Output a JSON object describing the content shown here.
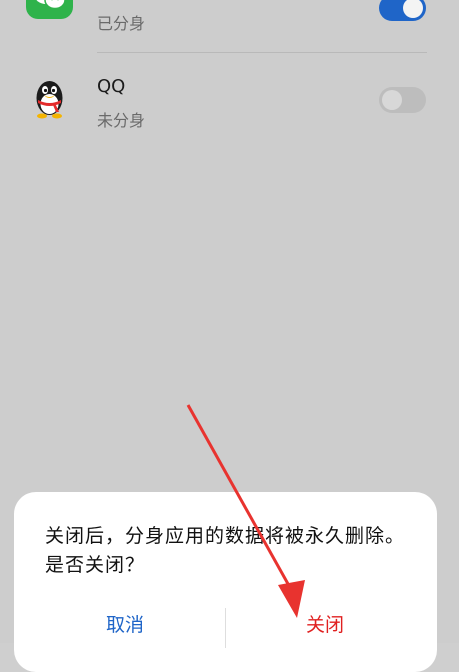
{
  "apps": [
    {
      "name": "微信",
      "status": "已分身",
      "clone_enabled": true,
      "icon": "wechat-icon"
    },
    {
      "name": "QQ",
      "status": "未分身",
      "clone_enabled": false,
      "icon": "qq-penguin-icon"
    }
  ],
  "dialog": {
    "message": "关闭后，分身应用的数据将被永久删除。是否关闭？",
    "cancel_label": "取消",
    "confirm_label": "关闭"
  },
  "colors": {
    "background": "#cdcdcd",
    "accent": "#1f65c8",
    "danger": "#e02020",
    "annotation": "#e8332f",
    "wechat_green": "#2fb34b"
  }
}
